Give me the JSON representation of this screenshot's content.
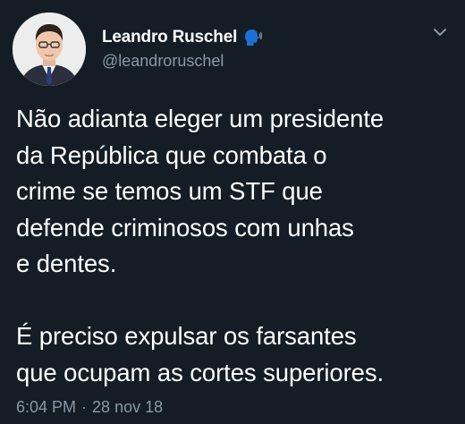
{
  "author": {
    "display_name": "Leandro Ruschel",
    "handle": "@leandroruschel",
    "name_emoji_icon": "speaking-head-icon"
  },
  "tweet": {
    "paragraphs": [
      "Não adianta eleger um presidente da República que combata o crime se temos um STF que defende criminosos com unhas e dentes.",
      "É preciso expulsar os farsantes que ocupam as cortes superiores."
    ],
    "display_text": "Não adianta eleger um presidente\nda República que combata o\ncrime se temos um STF que\ndefende criminosos com unhas\ne dentes.\n\nÉ preciso expulsar os farsantes\nque ocupam as cortes superiores."
  },
  "meta": {
    "time": "6:04 PM",
    "separator": "·",
    "date": "28 nov 18"
  },
  "icons": {
    "menu": "chevron-down-icon",
    "avatar": "avatar"
  },
  "colors": {
    "background": "#141d26",
    "text": "#ffffff",
    "secondary_text": "#8899a6",
    "emoji_blue": "#1d6fd6"
  }
}
